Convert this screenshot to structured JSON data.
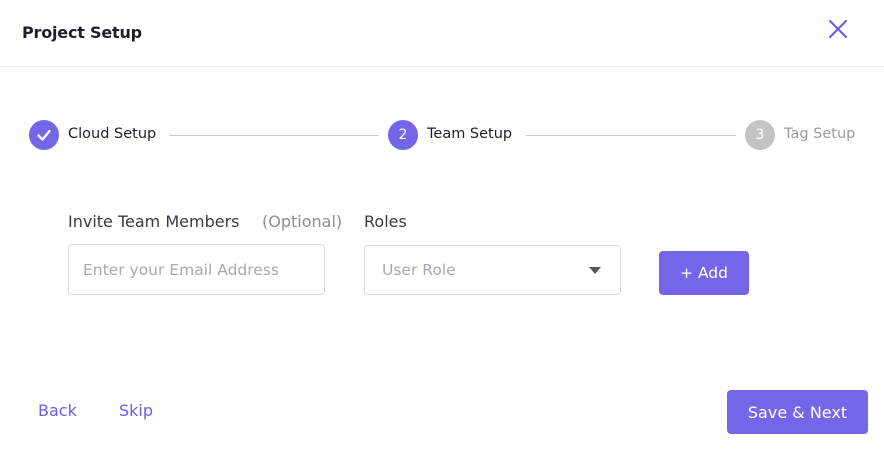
{
  "modal": {
    "title": "Project Setup",
    "close_icon": "close-icon"
  },
  "stepper": {
    "steps": [
      {
        "label": "Cloud Setup",
        "state": "completed",
        "icon": "check-icon"
      },
      {
        "label": "Team Setup",
        "number": "2",
        "state": "active"
      },
      {
        "label": "Tag Setup",
        "number": "3",
        "state": "pending"
      }
    ]
  },
  "form": {
    "invite_label": "Invite Team Members",
    "optional_label": "(Optional)",
    "email_placeholder": "Enter your Email Address",
    "email_value": "",
    "roles_label": "Roles",
    "role_selected": "User Role",
    "add_label": "+ Add"
  },
  "footer": {
    "back_label": "Back",
    "skip_label": "Skip",
    "save_label": "Save & Next"
  },
  "colors": {
    "accent": "#7366e8",
    "pending": "#c4c4c4"
  }
}
